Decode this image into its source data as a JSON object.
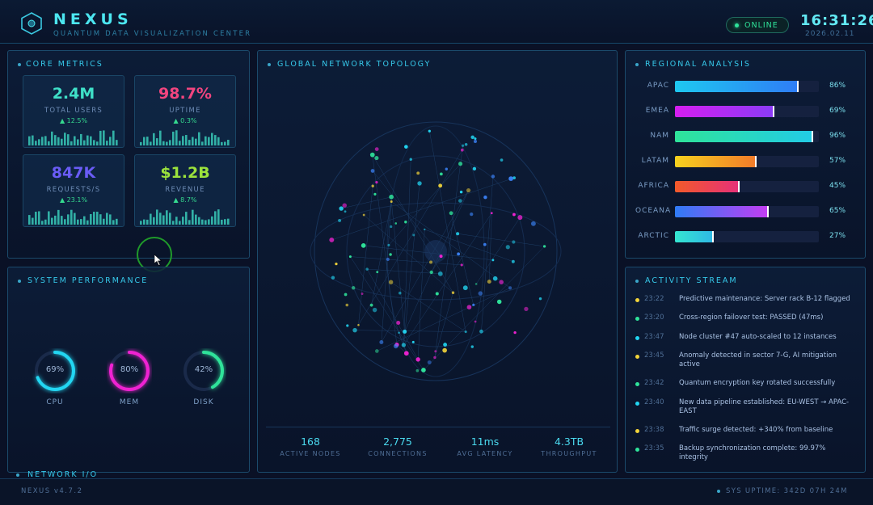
{
  "header": {
    "brand": "NEXUS",
    "subtitle": "QUANTUM DATA VISUALIZATION CENTER",
    "status": "ONLINE",
    "clock": "16:31:26",
    "date": "2026.02.11"
  },
  "colors": {
    "accent": "#4ce6f0",
    "users": "#3fe0c8",
    "uptime": "#f2457f",
    "requests": "#6a5cf6",
    "revenue": "#9be23c",
    "positive": "#35d98f"
  },
  "core_metrics": {
    "title": "CORE METRICS",
    "cards": [
      {
        "value": "2.4M",
        "label": "TOTAL USERS",
        "change": "▲ 12.5%",
        "color": "#3fe0c8"
      },
      {
        "value": "98.7%",
        "label": "UPTIME",
        "change": "▲ 0.3%",
        "color": "#f2457f"
      },
      {
        "value": "847K",
        "label": "REQUESTS/S",
        "change": "▲ 23.1%",
        "color": "#6a5cf6"
      },
      {
        "value": "$1.2B",
        "label": "REVENUE",
        "change": "▲ 8.7%",
        "color": "#9be23c"
      }
    ]
  },
  "system_performance": {
    "title": "SYSTEM PERFORMANCE",
    "gauges": [
      {
        "label": "CPU",
        "value": "69%",
        "fraction": 0.69,
        "color": "#22d6f2"
      },
      {
        "label": "MEM",
        "value": "80%",
        "fraction": 0.8,
        "color": "#f022d2"
      },
      {
        "label": "DISK",
        "value": "42%",
        "fraction": 0.42,
        "color": "#2fe39a"
      }
    ]
  },
  "topology": {
    "title": "GLOBAL NETWORK TOPOLOGY",
    "stats": [
      {
        "value": "168",
        "label": "ACTIVE NODES"
      },
      {
        "value": "2,775",
        "label": "CONNECTIONS"
      },
      {
        "value": "11ms",
        "label": "AVG LATENCY"
      },
      {
        "value": "4.3TB",
        "label": "THROUGHPUT"
      }
    ]
  },
  "regional": {
    "title": "REGIONAL ANALYSIS",
    "rows": [
      {
        "name": "APAC",
        "pct": "86%",
        "fraction": 0.86,
        "from": "#1ec8f0",
        "to": "#2f7cf6"
      },
      {
        "name": "EMEA",
        "pct": "69%",
        "fraction": 0.69,
        "from": "#d51ef0",
        "to": "#8a3cf6"
      },
      {
        "name": "NAM",
        "pct": "96%",
        "fraction": 0.96,
        "from": "#2fe39a",
        "to": "#22cbe6"
      },
      {
        "name": "LATAM",
        "pct": "57%",
        "fraction": 0.57,
        "from": "#f6d11e",
        "to": "#f27a2a"
      },
      {
        "name": "AFRICA",
        "pct": "45%",
        "fraction": 0.45,
        "from": "#f25a2a",
        "to": "#e6307a"
      },
      {
        "name": "OCEANA",
        "pct": "65%",
        "fraction": 0.65,
        "from": "#2f7cf6",
        "to": "#c43cf2"
      },
      {
        "name": "ARCTIC",
        "pct": "27%",
        "fraction": 0.27,
        "from": "#35e6d0",
        "to": "#2fb7e6"
      }
    ]
  },
  "activity": {
    "title": "ACTIVITY STREAM",
    "items": [
      {
        "time": "23:22",
        "msg": "Predictive maintenance: Server rack B-12 flagged",
        "color": "#f2d43a"
      },
      {
        "time": "23:20",
        "msg": "Cross-region failover test: PASSED (47ms)",
        "color": "#2fe39a"
      },
      {
        "time": "23:47",
        "msg": "Node cluster #47 auto-scaled to 12 instances",
        "color": "#22d6f2"
      },
      {
        "time": "23:45",
        "msg": "Anomaly detected in sector 7-G, AI mitigation active",
        "color": "#f2d43a"
      },
      {
        "time": "23:42",
        "msg": "Quantum encryption key rotated successfully",
        "color": "#2fe39a"
      },
      {
        "time": "23:40",
        "msg": "New data pipeline established: EU-WEST → APAC-EAST",
        "color": "#22d6f2"
      },
      {
        "time": "23:38",
        "msg": "Traffic surge detected: +340% from baseline",
        "color": "#f2d43a"
      },
      {
        "time": "23:35",
        "msg": "Backup synchronization complete: 99.97% integrity",
        "color": "#2fe39a"
      }
    ]
  },
  "network_io": {
    "title": "NETWORK I/O"
  },
  "footer": {
    "left": "NEXUS v4.7.2",
    "right": "SYS   UPTIME: 342D 07H 24M"
  }
}
